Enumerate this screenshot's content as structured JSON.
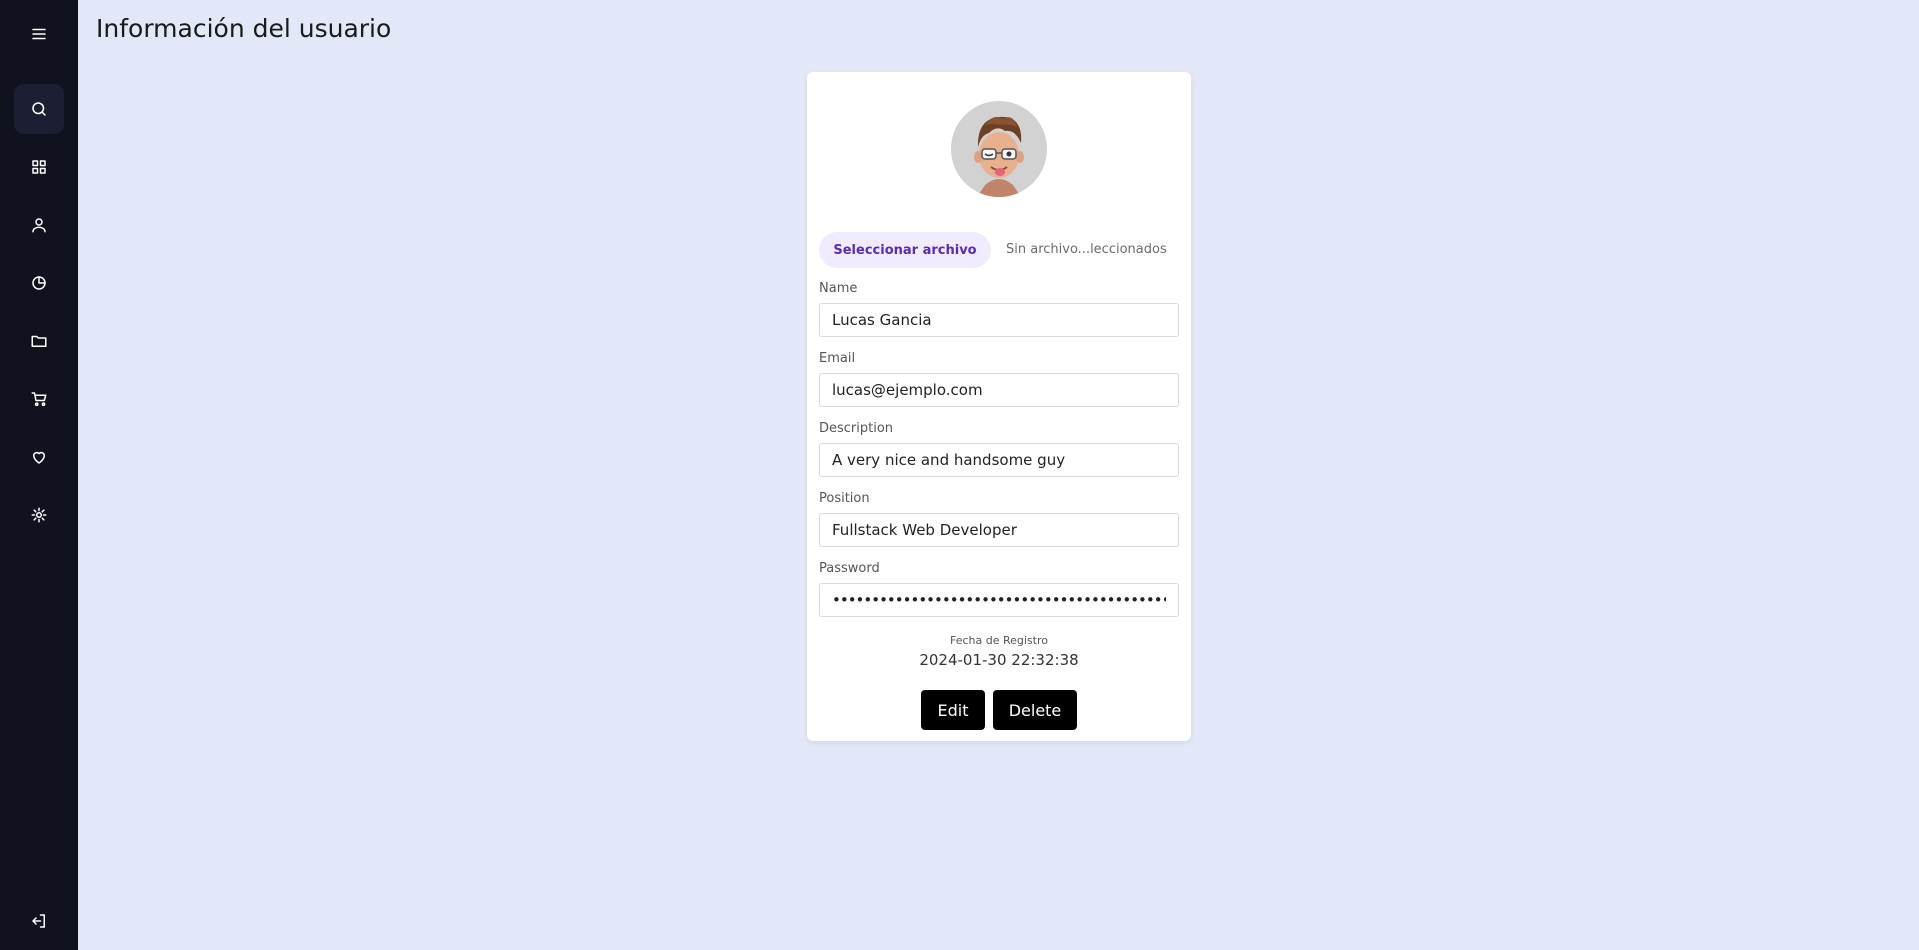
{
  "header": {
    "title": "Información del usuario"
  },
  "sidebar": {
    "items": [
      {
        "icon": "menu-icon"
      },
      {
        "icon": "search-icon",
        "active": true
      },
      {
        "icon": "dashboard-icon"
      },
      {
        "icon": "user-icon"
      },
      {
        "icon": "pie-chart-icon"
      },
      {
        "icon": "folder-icon"
      },
      {
        "icon": "cart-icon"
      },
      {
        "icon": "heart-icon"
      },
      {
        "icon": "settings-icon"
      },
      {
        "icon": "logout-icon"
      }
    ]
  },
  "profile": {
    "file_button": "Seleccionar archivo",
    "file_status": "Sin archivo...leccionados",
    "fields": {
      "name": {
        "label": "Name",
        "value": "Lucas Gancia"
      },
      "email": {
        "label": "Email",
        "value": "lucas@ejemplo.com"
      },
      "description": {
        "label": "Description",
        "value": "A very nice and handsome guy"
      },
      "position": {
        "label": "Position",
        "value": "Fullstack Web Developer"
      },
      "password": {
        "label": "Password",
        "value": "••••••••••••••••••••••••••••••••••••••••••••••••••••••••••••"
      }
    },
    "registration_label": "Fecha de Registro",
    "registration_date": "2024-01-30 22:32:38",
    "edit_label": "Edit",
    "delete_label": "Delete"
  },
  "colors": {
    "sidebar_bg": "#11121f",
    "page_bg": "#e2e8f7",
    "file_button_bg": "#f1ecfd",
    "file_button_text": "#5a2bb5",
    "action_button_bg": "#000000"
  }
}
